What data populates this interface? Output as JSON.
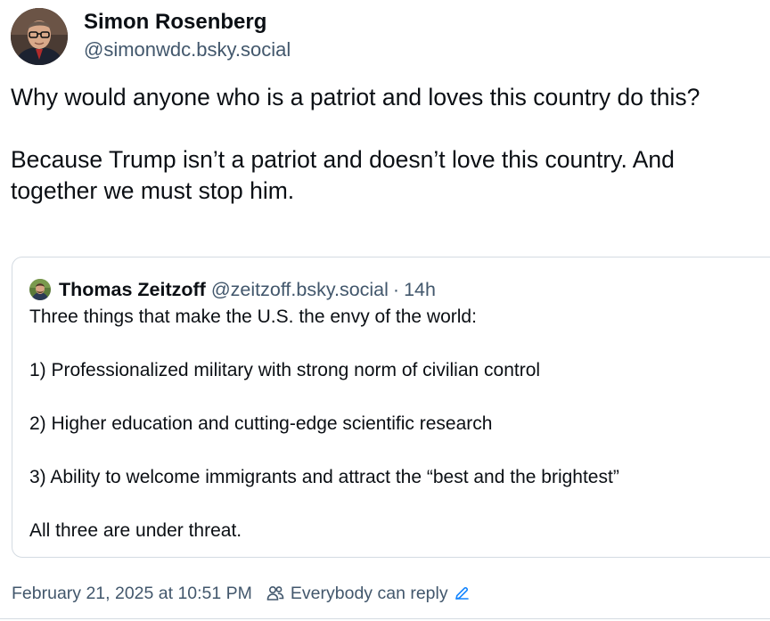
{
  "post": {
    "author_name": "Simon Rosenberg",
    "author_handle": "@simonwdc.bsky.social",
    "paragraphs": [
      "Why would anyone who is a patriot and loves this country do this?",
      "Because Trump isn’t a patriot and doesn’t love this country.  And together we must stop him."
    ]
  },
  "quote": {
    "author_name": "Thomas Zeitzoff",
    "author_handle": "@zeitzoff.bsky.social",
    "separator": "·",
    "time": "14h",
    "paragraphs": [
      "Three things that make the U.S. the envy of the world:",
      "1) Professionalized military with strong norm of civilian control",
      "2) Higher education and cutting-edge scientific research",
      "3) Ability to welcome  immigrants and attract the “best and the brightest”",
      "All three are under threat."
    ]
  },
  "meta": {
    "timestamp": "February 21, 2025 at 10:51 PM",
    "reply_setting": "Everybody can reply",
    "icons": [
      "people-icon",
      "pencil-icon"
    ]
  },
  "colors": {
    "text": "#0b0f14",
    "muted": "#42576c",
    "border": "#d4dbe2",
    "accent": "#1083fe"
  }
}
